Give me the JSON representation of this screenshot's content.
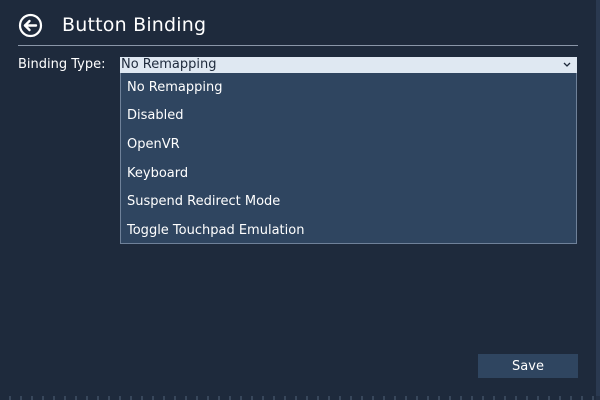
{
  "header": {
    "title": "Button Binding",
    "back_icon": "back-arrow-icon"
  },
  "binding": {
    "label": "Binding Type:",
    "selected": "No Remapping",
    "chevron": "chevron-down-icon",
    "options": [
      "No Remapping",
      "Disabled",
      "OpenVR",
      "Keyboard",
      "Suspend Redirect Mode",
      "Toggle Touchpad Emulation"
    ]
  },
  "footer": {
    "save_label": "Save"
  },
  "colors": {
    "background": "#1e2a3c",
    "dropdown": "#2f4560",
    "select_field": "#dfe8f2",
    "divider": "#8a96a8"
  }
}
